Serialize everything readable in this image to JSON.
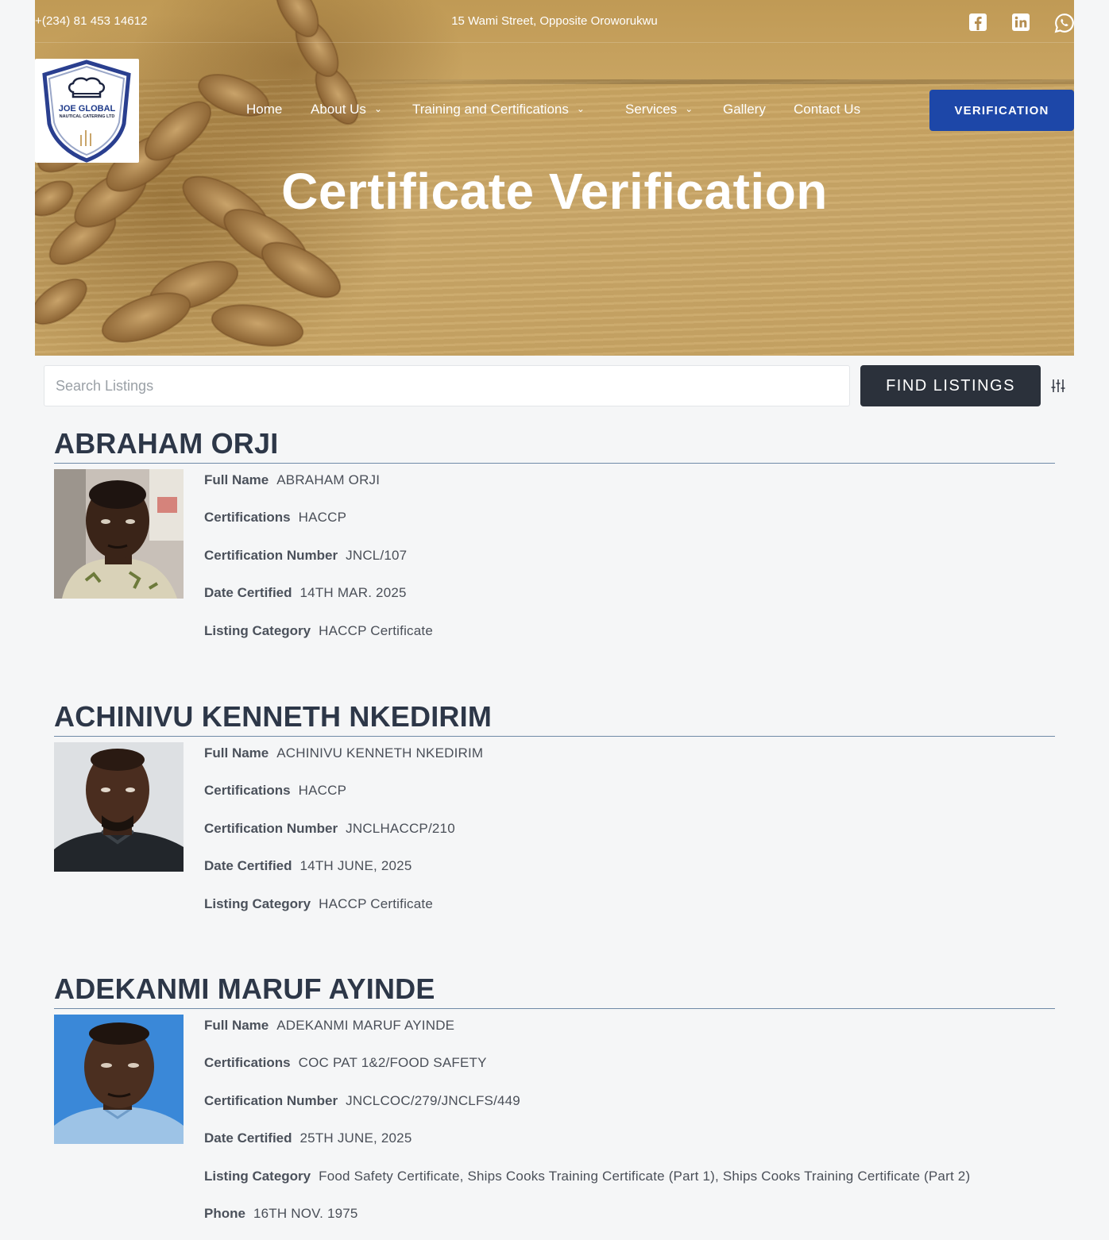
{
  "topbar": {
    "phone": "+(234) 81 453 14612",
    "address": "15 Wami Street, Opposite Oroworukwu",
    "social_icons": [
      "facebook-icon",
      "linkedin-icon",
      "whatsapp-icon"
    ]
  },
  "brand": {
    "logo_line1": "JOE GLOBAL",
    "logo_line2": "NAUTICAL CATERING LTD"
  },
  "nav": {
    "items": [
      {
        "label": "Home"
      },
      {
        "label": "About Us"
      },
      {
        "label": "Training and Certifications"
      },
      {
        "label": "Services"
      },
      {
        "label": "Gallery"
      },
      {
        "label": "Contact Us"
      }
    ],
    "cta": "VERIFICATION"
  },
  "hero": {
    "title": "Certificate Verification"
  },
  "search": {
    "placeholder": "Search Listings",
    "button": "FIND LISTINGS",
    "filter_icon": "sliders-icon"
  },
  "labels": {
    "full_name": "Full Name",
    "certifications": "Certifications",
    "cert_number": "Certification Number",
    "date": "Date Certified",
    "category": "Listing Category",
    "phone": "Phone"
  },
  "listings": [
    {
      "heading": "ABRAHAM ORJI",
      "full_name": "ABRAHAM ORJI",
      "certifications": "HACCP",
      "cert_number": "JNCL/107",
      "date": "14TH MAR. 2025",
      "category": "HACCP Certificate"
    },
    {
      "heading": "ACHINIVU KENNETH NKEDIRIM",
      "full_name": "ACHINIVU KENNETH NKEDIRIM",
      "certifications": "HACCP",
      "cert_number": "JNCLHACCP/210",
      "date": "14TH JUNE, 2025",
      "category": "HACCP Certificate"
    },
    {
      "heading": "ADEKANMI MARUF AYINDE",
      "full_name": "ADEKANMI MARUF AYINDE",
      "certifications": "COC PAT 1&2/FOOD SAFETY",
      "cert_number": "JNCLCOC/279/JNCLFS/449",
      "date": "25TH JUNE, 2025",
      "category": "Food Safety Certificate, Ships Cooks Training Certificate (Part 1), Ships Cooks Training Certificate (Part 2)",
      "phone": "16TH NOV. 1975"
    }
  ]
}
